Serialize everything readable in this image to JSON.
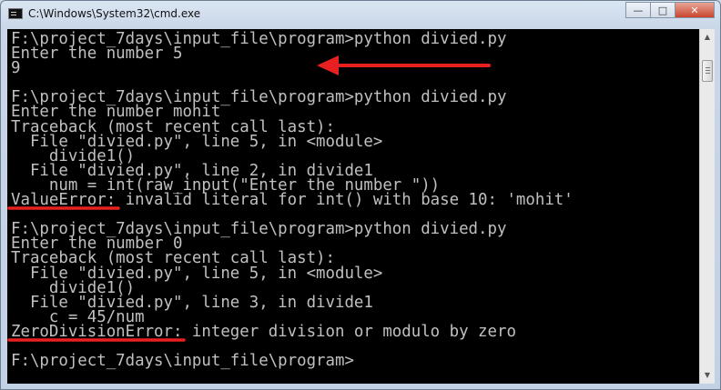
{
  "window": {
    "title": "C:\\Windows\\System32\\cmd.exe",
    "controls": {
      "minimize": "—",
      "maximize": "□",
      "close": "✕"
    }
  },
  "colors": {
    "console_bg": "#000000",
    "console_text": "#c0c0c0",
    "annotation_red": "#e8201f"
  },
  "console": {
    "lines": [
      "F:\\project_7days\\input_file\\program>python divied.py",
      "Enter the number 5",
      "9",
      "",
      "F:\\project_7days\\input_file\\program>python divied.py",
      "Enter the number mohit",
      "Traceback (most recent call last):",
      "  File \"divied.py\", line 5, in <module>",
      "    divide1()",
      "  File \"divied.py\", line 2, in divide1",
      "    num = int(raw_input(\"Enter the number \"))",
      "ValueError: invalid literal for int() with base 10: 'mohit'",
      "",
      "F:\\project_7days\\input_file\\program>python divied.py",
      "Enter the number 0",
      "Traceback (most recent call last):",
      "  File \"divied.py\", line 5, in <module>",
      "    divide1()",
      "  File \"divied.py\", line 3, in divide1",
      "    c = 45/num",
      "ZeroDivisionError: integer division or modulo by zero",
      "",
      "F:\\project_7days\\input_file\\program>"
    ]
  },
  "annotations": {
    "arrow_icon": "red-arrow-pointing-left",
    "underline_1": "red-underline-valueerror",
    "underline_2": "red-underline-zerodivisionerror"
  }
}
